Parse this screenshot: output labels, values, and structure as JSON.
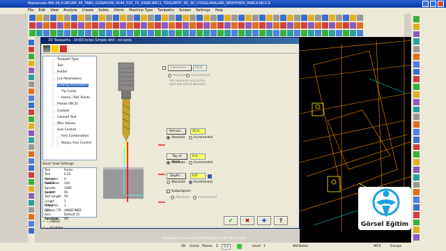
{
  "window": {
    "title": "Mastercam Mill X6  E:\\MCAM_X6_TABU_GUNAYDIN_0544_532_70_34\\MCAM11_TOOLPATH_3D_3D_UYGULAMALARI_NEW\\FISEK_PARCA.MCX-6"
  },
  "menu": [
    "File",
    "Edit",
    "View",
    "Analyze",
    "Create",
    "Solids",
    "Xform",
    "Machine Type",
    "Toolpaths",
    "Screen",
    "Settings",
    "Help"
  ],
  "dialog": {
    "title": "2D Toolpaths - Drill/Circles Simple drill - no peck",
    "tree": [
      {
        "label": "Toolpath Type",
        "indent": 1
      },
      {
        "label": "Tool",
        "indent": 1
      },
      {
        "label": "Holder",
        "indent": 1
      },
      {
        "label": "Cut Parameters",
        "indent": 1
      },
      {
        "label": "Linking Parameters",
        "indent": 1,
        "selected": true
      },
      {
        "label": "Tip Comp",
        "indent": 2
      },
      {
        "label": "Home / Ref. Points",
        "indent": 2
      },
      {
        "label": "Planes (WCS)",
        "indent": 1
      },
      {
        "label": "Coolant",
        "indent": 1
      },
      {
        "label": "Canned Text",
        "indent": 1
      },
      {
        "label": "Misc Values",
        "indent": 1
      },
      {
        "label": "Axis Control",
        "indent": 1
      },
      {
        "label": "Axis Combination",
        "indent": 2
      },
      {
        "label": "Rotary Axis Control",
        "indent": 2
      }
    ],
    "quick_view_title": "Quick View Settings",
    "quick_view": [
      [
        "Tool",
        "Punta"
      ],
      [
        "Tool Diameter",
        "6.25"
      ],
      [
        "Corner Radius",
        "0"
      ],
      [
        "Feed Rate",
        "120"
      ],
      [
        "Spindle Speed",
        "1400"
      ],
      [
        "Coolant",
        "On"
      ],
      [
        "Tool Length",
        "50"
      ],
      [
        "Length Offset",
        "1"
      ],
      [
        "Diameter Off...",
        "1"
      ],
      [
        "Cplane / TP...",
        "UNDEFINED"
      ],
      [
        "Axis Combinat...",
        "Default (1)"
      ],
      [
        "Tip comp",
        "Off"
      ]
    ],
    "legend": {
      "edited": "= edited",
      "disabled": "= disabled"
    },
    "clearance": {
      "label": "Clearance...",
      "value": "50.0",
      "use_label": "Use clearance only at the start and end of operation"
    },
    "retract": {
      "label": "Retract...",
      "value": "25.0",
      "absolute": "Absolute",
      "incremental": "Incremental"
    },
    "top_of_stock": {
      "label": "Top of stock...",
      "value": "0.0",
      "absolute": "Absolute",
      "incremental": "Incremental"
    },
    "depth": {
      "label": "Depth...",
      "value": "0.0",
      "absolute": "Absolute",
      "incremental": "Incremental"
    },
    "subprogram": {
      "label": "Subprogram",
      "absolute": "Absolute",
      "incremental": "Incremental"
    },
    "buttons": {
      "ok": "✔",
      "cancel": "✖",
      "add": "✚",
      "help": "?"
    }
  },
  "statusbar": {
    "mode": "2D",
    "gview": "Gview",
    "planes": "Planes",
    "z": "Z",
    "z_val": "0.0",
    "level_label": "Level",
    "level": "1",
    "attributes": "Attributes",
    "wcs": "WCS",
    "groups": "Groups"
  },
  "gview_msg": "Gview:Not Saved  WCS:TOP  T/Cplane:TOP (Not Saved)",
  "logo_text": "Görsel Eğitim",
  "colors": {
    "accent": "#ffff66",
    "highlight": "#0a246a",
    "red": "#e00000"
  }
}
